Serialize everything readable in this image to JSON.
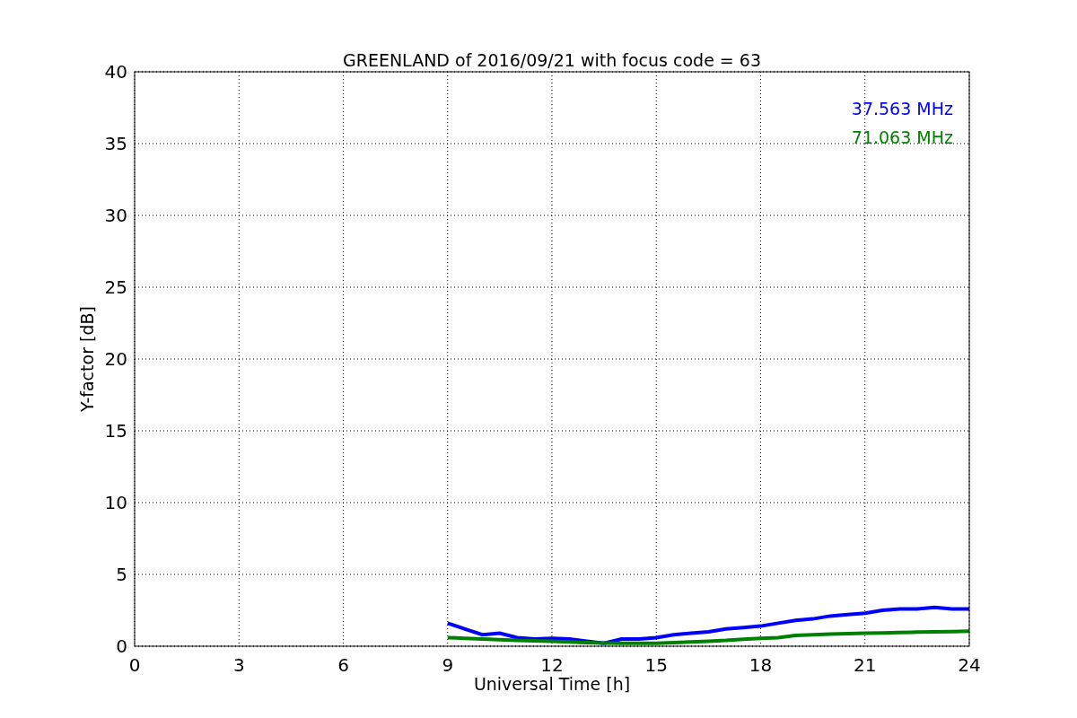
{
  "chart_data": {
    "type": "line",
    "title": "GREENLAND of 2016/09/21 with focus code = 63",
    "xlabel": "Universal Time [h]",
    "ylabel": "Y-factor [dB]",
    "x": [
      9,
      9.5,
      10,
      10.5,
      11,
      11.5,
      12,
      12.5,
      13,
      13.5,
      14,
      14.5,
      15,
      15.5,
      16,
      16.5,
      17,
      17.5,
      18,
      18.5,
      19,
      19.5,
      20,
      20.5,
      21,
      21.5,
      22,
      22.5,
      23,
      23.5,
      24
    ],
    "series": [
      {
        "name": "37.563 MHz",
        "color": "#0000ff",
        "values": [
          1.6,
          1.2,
          0.8,
          0.9,
          0.6,
          0.5,
          0.55,
          0.5,
          0.35,
          0.2,
          0.5,
          0.5,
          0.6,
          0.8,
          0.9,
          1.0,
          1.2,
          1.3,
          1.4,
          1.6,
          1.8,
          1.9,
          2.1,
          2.2,
          2.3,
          2.5,
          2.6,
          2.6,
          2.7,
          2.6,
          2.6
        ]
      },
      {
        "name": "71.063 MHz",
        "color": "#008000",
        "values": [
          0.6,
          0.55,
          0.5,
          0.45,
          0.4,
          0.38,
          0.35,
          0.3,
          0.25,
          0.22,
          0.2,
          0.2,
          0.2,
          0.25,
          0.3,
          0.35,
          0.4,
          0.48,
          0.55,
          0.6,
          0.75,
          0.8,
          0.85,
          0.88,
          0.9,
          0.92,
          0.95,
          0.98,
          1.0,
          1.02,
          1.05
        ]
      }
    ],
    "xlim": [
      0,
      24
    ],
    "ylim": [
      0,
      40
    ],
    "xticks": [
      0,
      3,
      6,
      9,
      12,
      15,
      18,
      21,
      24
    ],
    "yticks": [
      0,
      5,
      10,
      15,
      20,
      25,
      30,
      35,
      40
    ],
    "grid": true
  }
}
